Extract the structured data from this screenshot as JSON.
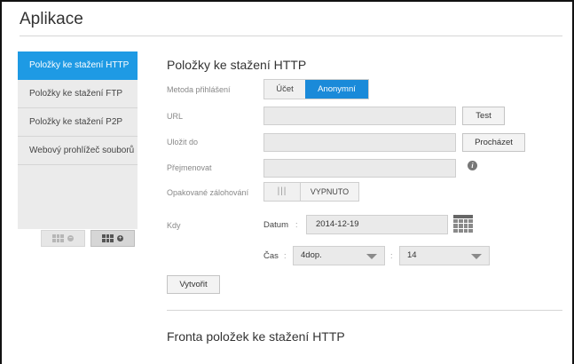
{
  "app": {
    "title": "Aplikace"
  },
  "sidebar": {
    "items": [
      {
        "label": "Položky ke stažení HTTP"
      },
      {
        "label": "Položky ke stažení FTP"
      },
      {
        "label": "Položky ke stažení P2P"
      },
      {
        "label": "Webový prohlížeč souborů"
      }
    ],
    "buttons": [
      {
        "icon": "app-grid-remove-icon",
        "state": "disabled"
      },
      {
        "icon": "app-grid-add-icon",
        "state": "enabled"
      }
    ]
  },
  "main": {
    "section_title": "Položky ke stažení HTTP",
    "login_method": {
      "label": "Metoda přihlášení",
      "options": [
        "Účet",
        "Anonymní"
      ],
      "selected": "Anonymní"
    },
    "url": {
      "label": "URL",
      "value": "",
      "button": "Test"
    },
    "save_to": {
      "label": "Uložit do",
      "value": "",
      "button": "Procházet"
    },
    "rename": {
      "label": "Přejmenovat",
      "value": ""
    },
    "repeat_backup": {
      "label": "Opakované zálohování",
      "knob": "|||",
      "state": "VYPNUTO"
    },
    "when": {
      "label": "Kdy",
      "date_label": "Datum",
      "date_value": "2014-12-19",
      "time_label": "Čas",
      "hour_value": "4dop.",
      "minute_value": "14",
      "separator": ":"
    },
    "create_button": "Vytvořit",
    "queue_title": "Fronta položek ke stažení HTTP"
  },
  "colors": {
    "accent": "#1e9ae4",
    "accent_dark": "#1a8ad9"
  }
}
